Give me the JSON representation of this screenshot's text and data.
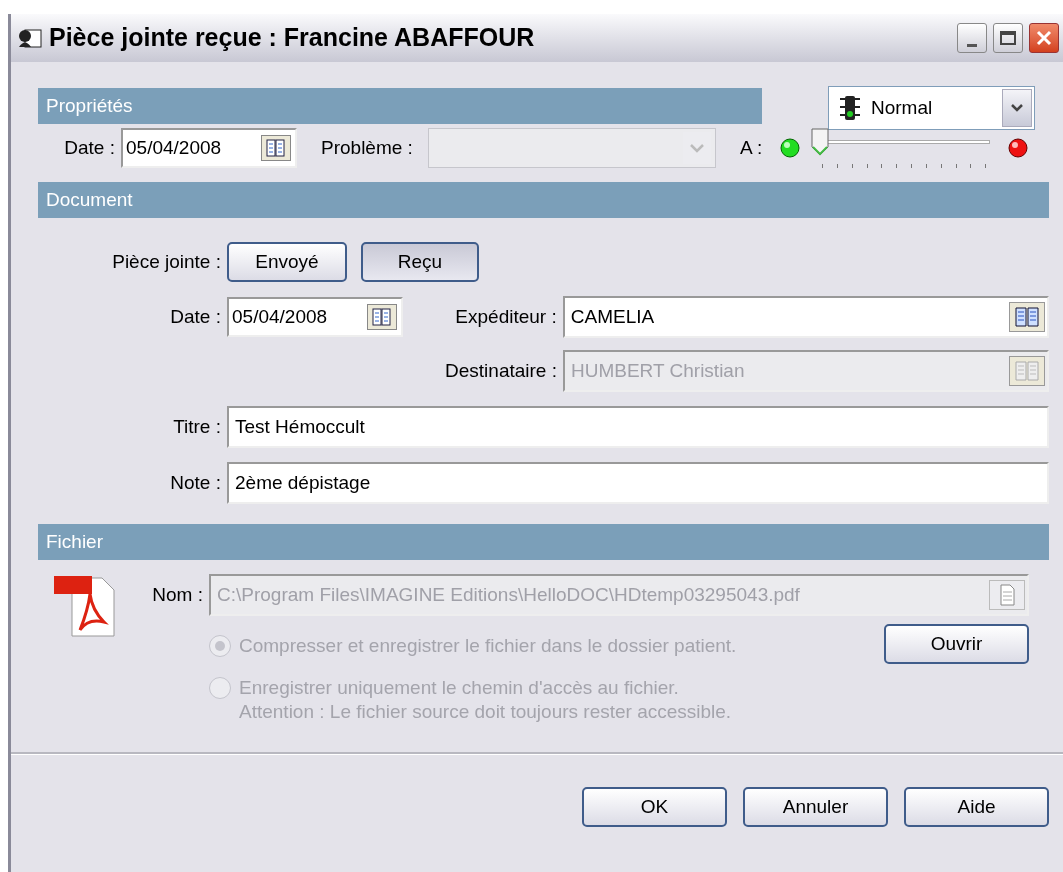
{
  "window": {
    "title": "Pièce jointe reçue : Francine ABAFFOUR"
  },
  "priority": {
    "value": "Normal"
  },
  "properties": {
    "header": "Propriétés",
    "date_label": "Date :",
    "date": "05/04/2008",
    "problem_label": "Problème :",
    "problem_disabled": true,
    "a_label": "A :",
    "slider": {
      "level": 0
    }
  },
  "document": {
    "header": "Document",
    "attachment_label": "Pièce jointe :",
    "attachment_buttons": [
      {
        "label": "Envoyé",
        "selected": false
      },
      {
        "label": "Reçu",
        "selected": true
      }
    ],
    "date_label": "Date :",
    "date": "05/04/2008",
    "sender_label": "Expéditeur :",
    "sender": "CAMELIA",
    "sender_disabled": false,
    "recipient_label": "Destinataire :",
    "recipient": "HUMBERT Christian",
    "recipient_disabled": true,
    "title_label": "Titre :",
    "title": "Test Hémoccult",
    "note_label": "Note :",
    "note": "2ème dépistage"
  },
  "file": {
    "header": "Fichier",
    "name_label": "Nom :",
    "name": "C:\\Program Files\\IMAGINE Editions\\HelloDOC\\HDtemp03295043.pdf",
    "options": [
      {
        "lines": [
          "Compresser et enregistrer le fichier dans le dossier patient."
        ],
        "selected": true,
        "disabled": true
      },
      {
        "lines": [
          "Enregistrer uniquement le chemin d'accès au fichier.",
          "Attention : Le fichier source doit toujours rester accessible."
        ],
        "selected": false,
        "disabled": true
      }
    ],
    "open_button": "Ouvrir"
  },
  "buttons": [
    "OK",
    "Annuler",
    "Aide"
  ]
}
